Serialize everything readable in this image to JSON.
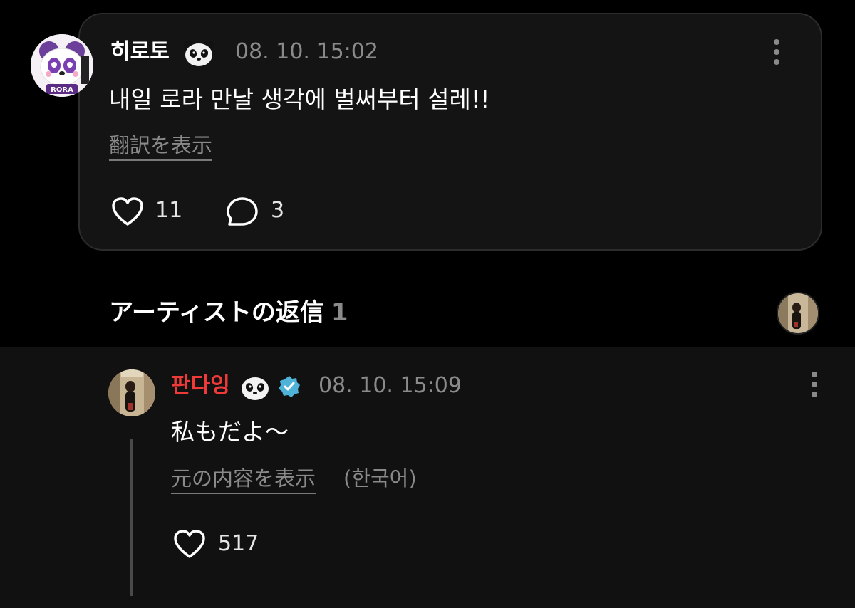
{
  "post": {
    "author": "히로토",
    "author_emoji": "panda-face",
    "avatar_text": "RORA",
    "timestamp": "08. 10. 15:02",
    "text": "내일 로라 만날 생각에 벌써부터 설레!!",
    "translate_label": "翻訳を表示",
    "like_count": "11",
    "comment_count": "3"
  },
  "artist_reply_header": {
    "title": "アーティストの返信",
    "count": "1"
  },
  "reply": {
    "author": "판다잉",
    "author_emoji": "panda-face",
    "verified": true,
    "timestamp": "08. 10. 15:09",
    "text": "私もだよ〜",
    "show_original_label": "元の内容を表示",
    "language_label": "(한국어)",
    "like_count": "517"
  },
  "colors": {
    "background": "#000000",
    "card": "#141414",
    "reply_bg": "#111111",
    "artist_name": "#ee3a38",
    "muted": "#8a8a8a",
    "verified": "#4fb3d9"
  }
}
